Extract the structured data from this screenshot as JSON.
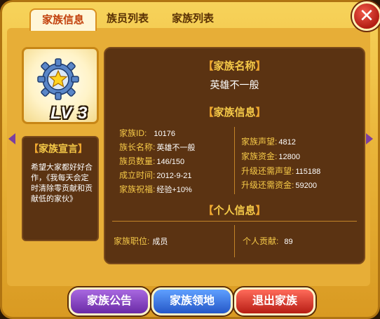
{
  "tabs": [
    "家族信息",
    "族员列表",
    "家族列表"
  ],
  "emblem": {
    "level_text": "LV 3"
  },
  "declaration": {
    "title": "家族宣言",
    "text": "希望大家都好好合作，《我每天会定时清除零贡献和贡献低的家伙》"
  },
  "clan_name_section": {
    "title": "家族名称",
    "value": "英雄不一般"
  },
  "clan_info_section": {
    "title": "家族信息",
    "left": [
      {
        "label": "家族ID:",
        "value": "10176"
      },
      {
        "label": "族长名称:",
        "value": "英雄不一般"
      },
      {
        "label": "族员数量:",
        "value": "146/150"
      },
      {
        "label": "成立时间:",
        "value": "2012-9-21"
      },
      {
        "label": "家族祝福:",
        "value": "经验+10%"
      }
    ],
    "right": [
      {
        "label": "家族声望:",
        "value": "4812"
      },
      {
        "label": "家族资金:",
        "value": "12800"
      },
      {
        "label": "升级还需声望:",
        "value": "115188"
      },
      {
        "label": "升级还需资金:",
        "value": "59200"
      }
    ]
  },
  "personal_section": {
    "title": "个人信息",
    "position_label": "家族职位:",
    "position_value": "成员",
    "contribution_label": "个人贡献:",
    "contribution_value": "89"
  },
  "buttons": {
    "notice": "家族公告",
    "territory": "家族领地",
    "quit": "退出家族"
  },
  "icons": {
    "close": "close-icon",
    "gear": "gear-star-icon"
  },
  "colors": {
    "accent": "#f5c948",
    "panel": "#5b3312",
    "frame": "#e7ae37"
  }
}
